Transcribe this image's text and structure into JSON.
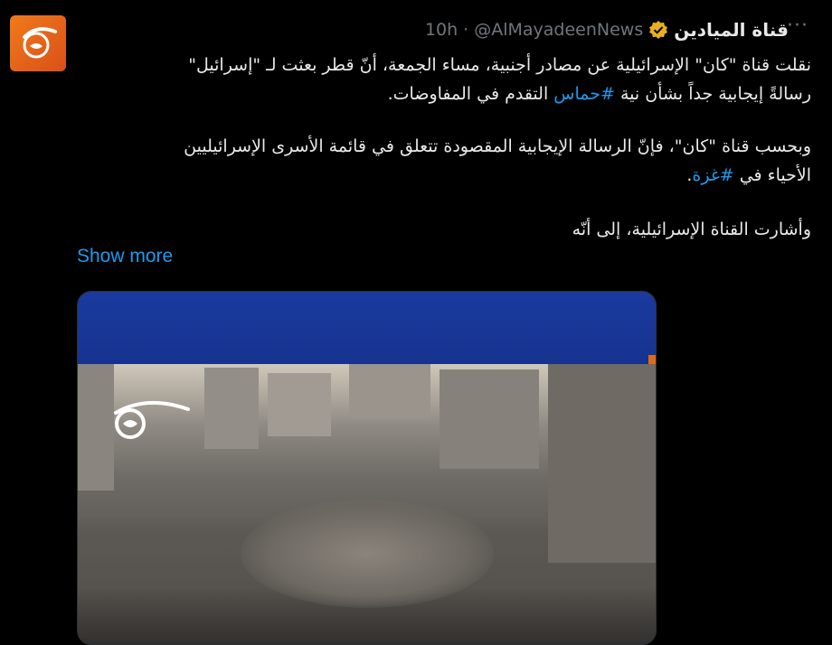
{
  "tweet": {
    "display_name": "قناة الميادين",
    "handle": "@AlMayadeenNews",
    "separator": "·",
    "time": "10h",
    "more_label": "···",
    "paragraph1": {
      "line1": "نقلت قناة \"كان\" الإسرائيلية عن مصادر أجنبية، مساء الجمعة، أنّ قطر بعثت لـ \"إسرائيل\"",
      "line2_before": "رسالةً إيجابية جداً بشأن نية ",
      "line2_hashtag": "#حماس",
      "line2_after": " التقدم في المفاوضات."
    },
    "paragraph2": {
      "line1": "وبحسب قناة \"كان\"، فإنّ الرسالة الإيجابية المقصودة تتعلق في قائمة الأسرى الإسرائيليين",
      "line2_before": "الأحياء في ",
      "line2_hashtag": "#غزة",
      "line2_after": "."
    },
    "paragraph3": "وأشارت القناة الإسرائيلية، إلى أنّه",
    "show_more": "Show more"
  },
  "colors": {
    "background": "#000000",
    "text": "#e7e9ea",
    "secondary": "#71767b",
    "link": "#1d9bf0",
    "verified": "#e8b020",
    "brand_orange": "#e06a1a",
    "media_blue": "#1a3aa0"
  }
}
